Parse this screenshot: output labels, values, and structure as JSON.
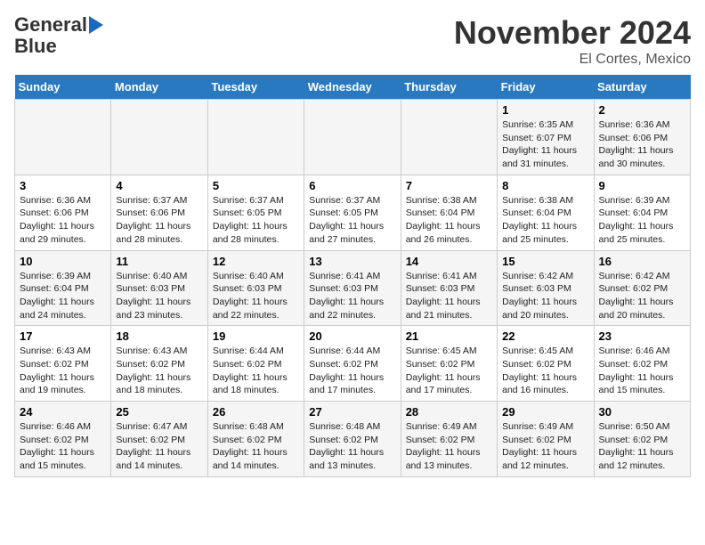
{
  "header": {
    "logo_line1": "General",
    "logo_line2": "Blue",
    "month_title": "November 2024",
    "location": "El Cortes, Mexico"
  },
  "days_of_week": [
    "Sunday",
    "Monday",
    "Tuesday",
    "Wednesday",
    "Thursday",
    "Friday",
    "Saturday"
  ],
  "weeks": [
    [
      {
        "day": "",
        "info": ""
      },
      {
        "day": "",
        "info": ""
      },
      {
        "day": "",
        "info": ""
      },
      {
        "day": "",
        "info": ""
      },
      {
        "day": "",
        "info": ""
      },
      {
        "day": "1",
        "info": "Sunrise: 6:35 AM\nSunset: 6:07 PM\nDaylight: 11 hours and 31 minutes."
      },
      {
        "day": "2",
        "info": "Sunrise: 6:36 AM\nSunset: 6:06 PM\nDaylight: 11 hours and 30 minutes."
      }
    ],
    [
      {
        "day": "3",
        "info": "Sunrise: 6:36 AM\nSunset: 6:06 PM\nDaylight: 11 hours and 29 minutes."
      },
      {
        "day": "4",
        "info": "Sunrise: 6:37 AM\nSunset: 6:06 PM\nDaylight: 11 hours and 28 minutes."
      },
      {
        "day": "5",
        "info": "Sunrise: 6:37 AM\nSunset: 6:05 PM\nDaylight: 11 hours and 28 minutes."
      },
      {
        "day": "6",
        "info": "Sunrise: 6:37 AM\nSunset: 6:05 PM\nDaylight: 11 hours and 27 minutes."
      },
      {
        "day": "7",
        "info": "Sunrise: 6:38 AM\nSunset: 6:04 PM\nDaylight: 11 hours and 26 minutes."
      },
      {
        "day": "8",
        "info": "Sunrise: 6:38 AM\nSunset: 6:04 PM\nDaylight: 11 hours and 25 minutes."
      },
      {
        "day": "9",
        "info": "Sunrise: 6:39 AM\nSunset: 6:04 PM\nDaylight: 11 hours and 25 minutes."
      }
    ],
    [
      {
        "day": "10",
        "info": "Sunrise: 6:39 AM\nSunset: 6:04 PM\nDaylight: 11 hours and 24 minutes."
      },
      {
        "day": "11",
        "info": "Sunrise: 6:40 AM\nSunset: 6:03 PM\nDaylight: 11 hours and 23 minutes."
      },
      {
        "day": "12",
        "info": "Sunrise: 6:40 AM\nSunset: 6:03 PM\nDaylight: 11 hours and 22 minutes."
      },
      {
        "day": "13",
        "info": "Sunrise: 6:41 AM\nSunset: 6:03 PM\nDaylight: 11 hours and 22 minutes."
      },
      {
        "day": "14",
        "info": "Sunrise: 6:41 AM\nSunset: 6:03 PM\nDaylight: 11 hours and 21 minutes."
      },
      {
        "day": "15",
        "info": "Sunrise: 6:42 AM\nSunset: 6:03 PM\nDaylight: 11 hours and 20 minutes."
      },
      {
        "day": "16",
        "info": "Sunrise: 6:42 AM\nSunset: 6:02 PM\nDaylight: 11 hours and 20 minutes."
      }
    ],
    [
      {
        "day": "17",
        "info": "Sunrise: 6:43 AM\nSunset: 6:02 PM\nDaylight: 11 hours and 19 minutes."
      },
      {
        "day": "18",
        "info": "Sunrise: 6:43 AM\nSunset: 6:02 PM\nDaylight: 11 hours and 18 minutes."
      },
      {
        "day": "19",
        "info": "Sunrise: 6:44 AM\nSunset: 6:02 PM\nDaylight: 11 hours and 18 minutes."
      },
      {
        "day": "20",
        "info": "Sunrise: 6:44 AM\nSunset: 6:02 PM\nDaylight: 11 hours and 17 minutes."
      },
      {
        "day": "21",
        "info": "Sunrise: 6:45 AM\nSunset: 6:02 PM\nDaylight: 11 hours and 17 minutes."
      },
      {
        "day": "22",
        "info": "Sunrise: 6:45 AM\nSunset: 6:02 PM\nDaylight: 11 hours and 16 minutes."
      },
      {
        "day": "23",
        "info": "Sunrise: 6:46 AM\nSunset: 6:02 PM\nDaylight: 11 hours and 15 minutes."
      }
    ],
    [
      {
        "day": "24",
        "info": "Sunrise: 6:46 AM\nSunset: 6:02 PM\nDaylight: 11 hours and 15 minutes."
      },
      {
        "day": "25",
        "info": "Sunrise: 6:47 AM\nSunset: 6:02 PM\nDaylight: 11 hours and 14 minutes."
      },
      {
        "day": "26",
        "info": "Sunrise: 6:48 AM\nSunset: 6:02 PM\nDaylight: 11 hours and 14 minutes."
      },
      {
        "day": "27",
        "info": "Sunrise: 6:48 AM\nSunset: 6:02 PM\nDaylight: 11 hours and 13 minutes."
      },
      {
        "day": "28",
        "info": "Sunrise: 6:49 AM\nSunset: 6:02 PM\nDaylight: 11 hours and 13 minutes."
      },
      {
        "day": "29",
        "info": "Sunrise: 6:49 AM\nSunset: 6:02 PM\nDaylight: 11 hours and 12 minutes."
      },
      {
        "day": "30",
        "info": "Sunrise: 6:50 AM\nSunset: 6:02 PM\nDaylight: 11 hours and 12 minutes."
      }
    ]
  ]
}
